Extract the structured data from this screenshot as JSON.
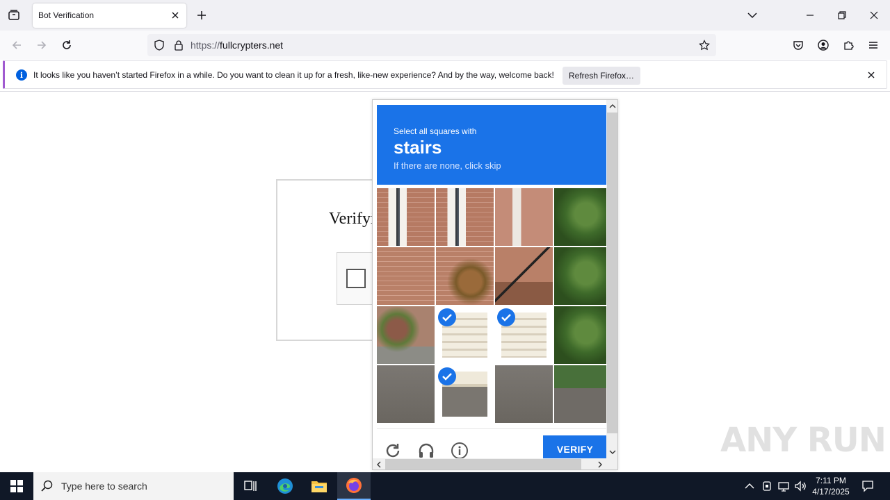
{
  "browser": {
    "tab_title": "Bot Verification",
    "url_scheme": "https://",
    "url_host": "fullcrypters.net"
  },
  "notification": {
    "message": "It looks like you haven’t started Firefox in a while. Do you want to clean it up for a fresh, like-new experience? And by the way, welcome back!",
    "button_label": "Refresh Firefox…",
    "info_glyph": "i"
  },
  "page": {
    "title": "Verifyi"
  },
  "challenge": {
    "instruction": "Select all squares with",
    "target_word": "stairs",
    "hint": "If there are none, click skip",
    "verify_label": "VERIFY",
    "tiles": [
      {
        "row": 0,
        "col": 0,
        "selected": false,
        "scene": "brick-window"
      },
      {
        "row": 0,
        "col": 1,
        "selected": false,
        "scene": "brick-window"
      },
      {
        "row": 0,
        "col": 2,
        "selected": false,
        "scene": "porch-column"
      },
      {
        "row": 0,
        "col": 3,
        "selected": false,
        "scene": "shrub"
      },
      {
        "row": 1,
        "col": 0,
        "selected": false,
        "scene": "brick-wall"
      },
      {
        "row": 1,
        "col": 1,
        "selected": false,
        "scene": "brick-bush"
      },
      {
        "row": 1,
        "col": 2,
        "selected": false,
        "scene": "brick-railing"
      },
      {
        "row": 1,
        "col": 3,
        "selected": false,
        "scene": "shrub"
      },
      {
        "row": 2,
        "col": 0,
        "selected": false,
        "scene": "bush-ground"
      },
      {
        "row": 2,
        "col": 1,
        "selected": true,
        "scene": "stairs"
      },
      {
        "row": 2,
        "col": 2,
        "selected": true,
        "scene": "stairs"
      },
      {
        "row": 2,
        "col": 3,
        "selected": false,
        "scene": "shrub"
      },
      {
        "row": 3,
        "col": 0,
        "selected": false,
        "scene": "asphalt"
      },
      {
        "row": 3,
        "col": 1,
        "selected": true,
        "scene": "step-asphalt"
      },
      {
        "row": 3,
        "col": 2,
        "selected": false,
        "scene": "asphalt"
      },
      {
        "row": 3,
        "col": 3,
        "selected": false,
        "scene": "asphalt-shrub"
      }
    ]
  },
  "watermark": "ANY RUN",
  "taskbar": {
    "search_placeholder": "Type here to search",
    "time": "7:11 PM",
    "date": "4/17/2025"
  },
  "colors": {
    "accent_blue": "#1a73e8",
    "firefox_info": "#0060df",
    "taskbar_bg": "#101827"
  }
}
